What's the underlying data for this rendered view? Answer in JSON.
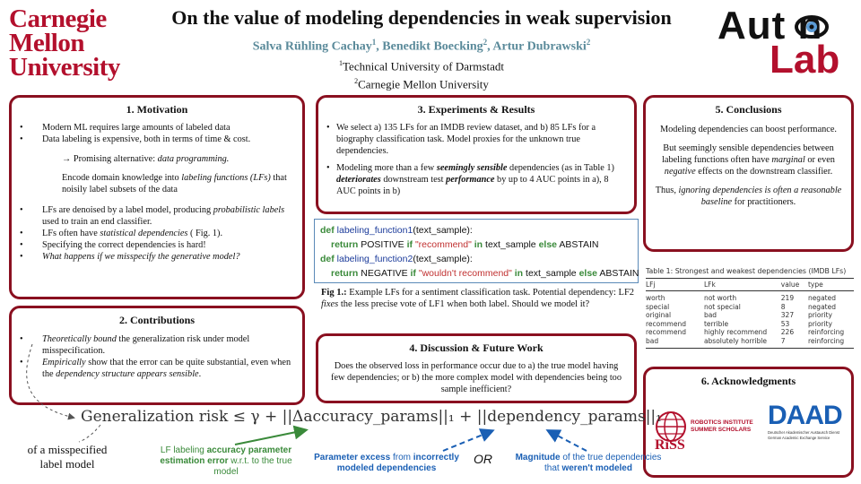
{
  "header": {
    "title": "On the value of modeling dependencies in weak supervision",
    "authors": [
      {
        "name": "Salva Rühling Cachay",
        "sup": "1"
      },
      {
        "name": "Benedikt Boecking",
        "sup": "2"
      },
      {
        "name": "Artur Dubrawski",
        "sup": "2"
      }
    ],
    "author_sep": ", ",
    "affiliations": [
      {
        "sup": "1",
        "name": "Technical University of Darmstadt"
      },
      {
        "sup": "2",
        "name": "Carnegie Mellon University"
      }
    ]
  },
  "logos": {
    "cmu_lines": [
      "Carnegie",
      "Mellon",
      "University"
    ],
    "auton_top": "Aut n",
    "auton_bottom": "Lab"
  },
  "motivation": {
    "title": "1. Motivation",
    "bullets1": [
      "Modern ML requires large amounts of labeled data",
      "Data labeling  is expensive, both in terms of time & cost."
    ],
    "alt_prefix": "→ Promising alternative: ",
    "alt_em": "data programming.",
    "encode_a": "Encode domain knowledge into ",
    "encode_em": "labeling functions (LFs)",
    "encode_b": "  that noisily label subsets of the data",
    "b3_a": "LFs are denoised by a label model, producing ",
    "b3_em": "probabilistic labels",
    "b3_b": " used to train an end classifier.",
    "b4_a": "LFs often have ",
    "b4_em": "statistical dependencies",
    "b4_b": " ( Fig. 1).",
    "b5": "Specifying the correct dependencies is hard!",
    "b6": "What happens if we misspecify the generative model?"
  },
  "contributions": {
    "title": "2. Contributions",
    "c1_em": "Theoretically bound",
    "c1_b": " the generalization risk under model misspecification.",
    "c2_em": "Empirically",
    "c2_b": " show that the error can be quite substantial, even when the ",
    "c2_em2": "dependency structure appears sensible",
    "c2_c": "."
  },
  "experiments": {
    "title": "3. Experiments & Results",
    "e1": "We select a) 135 LFs for an IMDB review dataset, and  b) 85 LFs for a biography classification task. Model proxies for the unknown true dependencies.",
    "e2_a": "Modeling more than a few ",
    "e2_em1": "seemingly sensible",
    "e2_b": " dependencies (as in Table 1) ",
    "e2_em2": "deteriorates",
    "e2_c": " downstream test ",
    "e2_em3": "performance",
    "e2_d": " by up to 4 AUC points in a), 8 AUC points in b)"
  },
  "code": {
    "l1_def": "def",
    "l1_fn": "labeling_function1",
    "l1_arg": "(text_sample):",
    "l2_ret": "return",
    "l2_label": " POSITIVE ",
    "l2_if": "if",
    "l2_str": " \"recommend\" ",
    "l2_in": "in",
    "l2_var": " text_sample ",
    "l2_else": "else",
    "l2_abstain": " ABSTAIN",
    "l3_def": "def",
    "l3_fn": "labeling_function2",
    "l3_arg": "(text_sample):",
    "l4_ret": "return",
    "l4_label": " NEGATIVE ",
    "l4_if": "if",
    "l4_str": " \"wouldn't recommend\" ",
    "l4_in": "in",
    "l4_var": " text_sample ",
    "l4_else": "else",
    "l4_abstain": " ABSTAIN"
  },
  "figure_caption": {
    "label": "Fig 1.:",
    "a": " Example LFs for a sentiment classification task. Potential dependency:  LF2 ",
    "em": "fixes",
    "b": " the less precise vote of LF1 when both label. Should we model it?"
  },
  "discussion": {
    "title": "4. Discussion & Future Work",
    "text": "Does the observed loss in performance occur due to a) the true model having few dependencies; or b) the more complex model with dependencies being too sample inefficient?"
  },
  "conclusions": {
    "title": "5. Conclusions",
    "p1": "Modeling dependencies can boost performance.",
    "p2_a": "But seemingly sensible dependencies between labeling functions often have ",
    "p2_em1": "marginal",
    "p2_b": " or even ",
    "p2_em2": "negative",
    "p2_c": " effects on the downstream classifier.",
    "p3_a": "Thus, ",
    "p3_em": "ignoring dependencies is often a reasonable baseline",
    "p3_b": " for practitioners."
  },
  "table": {
    "caption": "Table 1: Strongest and weakest dependencies (IMDB LFs)",
    "headers": [
      "LFj",
      "LFk",
      "value",
      "type"
    ],
    "rows": [
      [
        "worth",
        "not worth",
        "219",
        "negated"
      ],
      [
        "special",
        "not special",
        "8",
        "negated"
      ],
      [
        "original",
        "bad",
        "327",
        "priority"
      ],
      [
        "recommend",
        "terrible",
        "53",
        "priority"
      ],
      [
        "recommend",
        "highly recommend",
        "226",
        "reinforcing"
      ],
      [
        "bad",
        "absolutely horrible",
        "7",
        "reinforcing"
      ]
    ]
  },
  "acknowledgments": {
    "title": "6. Acknowledgments",
    "riss_lines": [
      "ROBOTICS INSTITUTE",
      "SUMMER SCHOLARS"
    ],
    "riss_mark": "RiSS",
    "daad": "DAAD",
    "daad_sub1": "Deutscher Akademischer Austausch Dienst",
    "daad_sub2": "German Academic Exchange Service"
  },
  "formula": {
    "text": "Generalization risk ≤ γ + ||Δaccuracy_params||₁ + ||dependency_params||₁",
    "misspec": "of a misspecified label model",
    "green_a": "LF labeling ",
    "green_b": "accuracy parameter estimation error",
    "green_c": " w.r.t. to the true model",
    "blue1_a": "Parameter excess",
    "blue1_b": " from ",
    "blue1_c": "incorrectly modeled dependencies",
    "or": "OR",
    "blue2_a": "Magnitude",
    "blue2_b": " of the true dependencies that ",
    "blue2_c": "weren't modeled"
  },
  "colors": {
    "cmu_red": "#b3102d",
    "box_border": "#8a1020",
    "author_teal": "#5a8a9a",
    "code_green": "#3a8a3a",
    "code_blue": "#1a3a9a",
    "code_red": "#c03030",
    "annotation_blue": "#1a5fb4"
  }
}
